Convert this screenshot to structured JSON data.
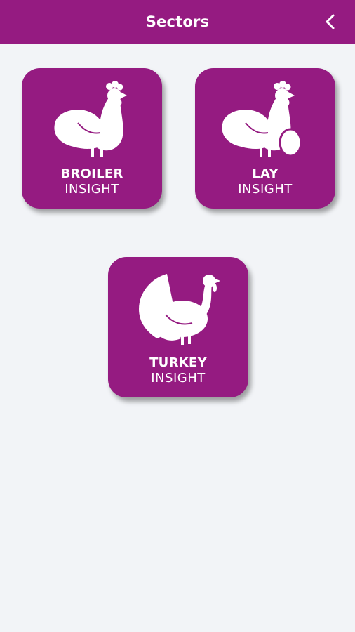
{
  "header": {
    "title": "Sectors",
    "back_icon": "chevron-left-icon"
  },
  "colors": {
    "brand": "#951b81",
    "background": "#f2f4f7",
    "tile_text": "#ffffff"
  },
  "sectors": [
    {
      "icon": "rooster-icon",
      "title": "BROILER",
      "subtitle": "INSIGHT"
    },
    {
      "icon": "hen-egg-icon",
      "title": "LAY",
      "subtitle": "INSIGHT"
    },
    {
      "icon": "turkey-icon",
      "title": "TURKEY",
      "subtitle": "INSIGHT"
    }
  ]
}
